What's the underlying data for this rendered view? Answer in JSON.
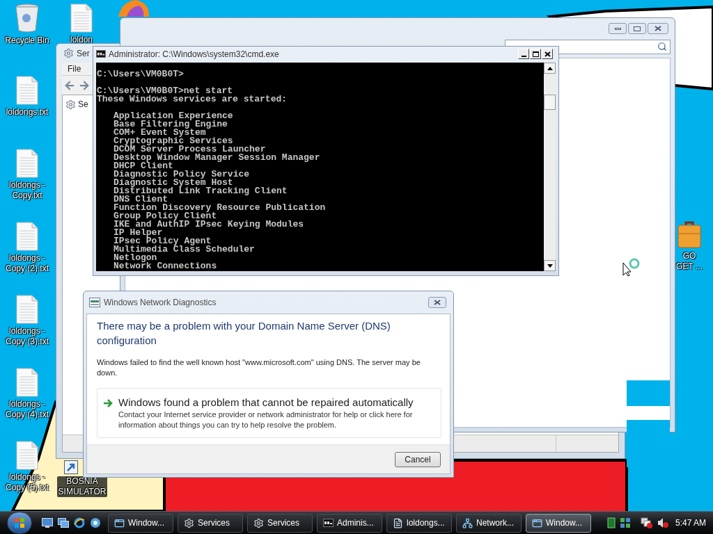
{
  "desktop_icons": [
    {
      "kind": "recycle_bin",
      "label": "Recycle Bin"
    },
    {
      "kind": "text_file",
      "label": "loldongs.txt"
    },
    {
      "kind": "text_file",
      "label": "loldongs - Copy.txt"
    },
    {
      "kind": "text_file",
      "label": "loldongs - Copy (2).txt"
    },
    {
      "kind": "text_file",
      "label": "loldongs - Copy (3).txt"
    },
    {
      "kind": "text_file",
      "label": "loldongs - Copy (4).txt"
    },
    {
      "kind": "text_file",
      "label": "loldongs - Copy (5).txt"
    }
  ],
  "desktop_extra_icons": [
    {
      "kind": "text_file",
      "label": "loldon"
    },
    {
      "kind": "shortcut",
      "label": "BOSNIA SIMULATOR"
    },
    {
      "kind": "briefcase",
      "label": "GO GET ..."
    }
  ],
  "services_window": {
    "title": "Ser",
    "menu": [
      "File"
    ],
    "tree": [
      "Se"
    ]
  },
  "console_window": {
    "title": "Administrator: C:\\Windows\\system32\\cmd.exe",
    "blocks": [
      {
        "kind": "output",
        "lines": [
          "C:\\Users\\VM0B0T>"
        ]
      },
      {
        "kind": "output",
        "lines": [
          "C:\\Users\\VM0B0T>net start",
          "These Windows services are started:"
        ]
      },
      {
        "kind": "list",
        "lines": [
          "Application Experience",
          "Base Filtering Engine",
          "COM+ Event System",
          "Cryptographic Services",
          "DCOM Server Process Launcher",
          "Desktop Window Manager Session Manager",
          "DHCP Client",
          "Diagnostic Policy Service",
          "Diagnostic System Host",
          "Distributed Link Tracking Client",
          "DNS Client",
          "Function Discovery Resource Publication",
          "Group Policy Client",
          "IKE and AuthIP IPsec Keying Modules",
          "IP Helper",
          "IPsec Policy Agent",
          "Multimedia Class Scheduler",
          "Netlogon",
          "Network Connections"
        ]
      }
    ]
  },
  "dialog": {
    "title": "Windows Network Diagnostics",
    "heading": "There may be a problem with your Domain Name Server (DNS) configuration",
    "message": "Windows failed to find the well known host \"www.microsoft.com\" using DNS. The server may be down.",
    "option": {
      "title": "Windows found a problem that cannot be repaired automatically",
      "description": "Contact your Internet service provider or network administrator for help or click here for information about things you can try to help resolve the problem."
    },
    "buttons": [
      "Cancel"
    ]
  },
  "taskbar": {
    "tasks": [
      {
        "kind": "explorer",
        "label": "Window...",
        "selected": false
      },
      {
        "kind": "services",
        "label": "Services",
        "selected": false
      },
      {
        "kind": "services",
        "label": "Services",
        "selected": false
      },
      {
        "kind": "console",
        "label": "Adminis...",
        "selected": false
      },
      {
        "kind": "notepad",
        "label": "loldongs...",
        "selected": false
      },
      {
        "kind": "network",
        "label": "Network...",
        "selected": false
      },
      {
        "kind": "dialog",
        "label": "Window...",
        "selected": true
      }
    ],
    "clock": "5:47 AM"
  }
}
